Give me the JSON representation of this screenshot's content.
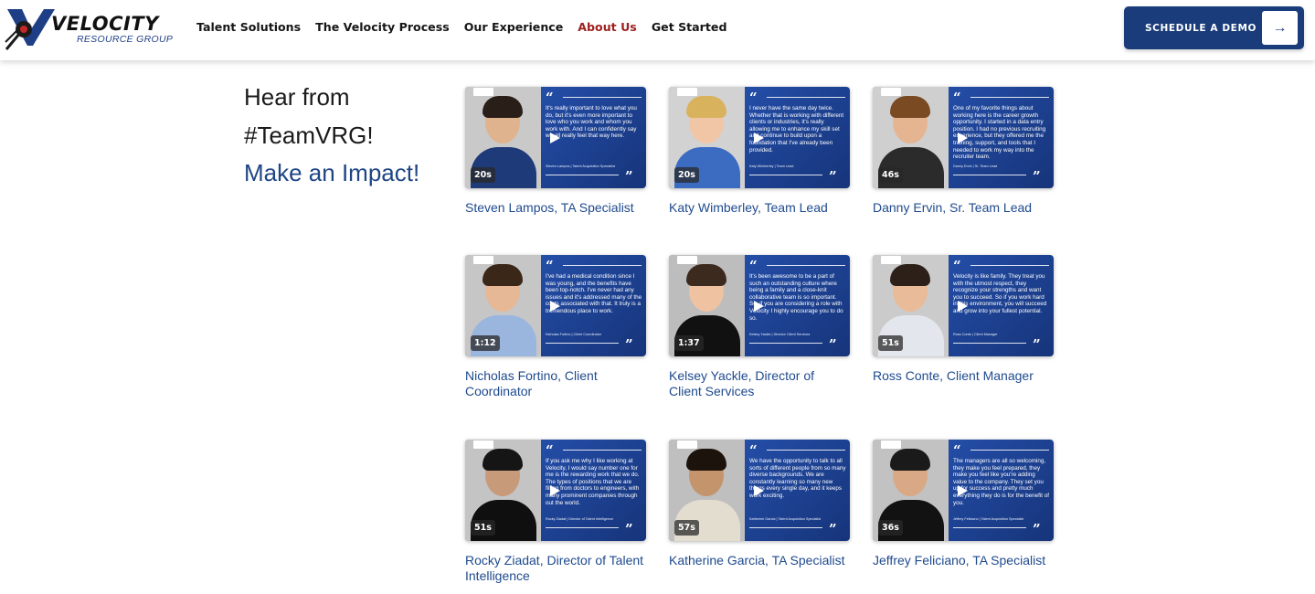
{
  "brand": {
    "name": "VELOCITY",
    "subtitle": "RESOURCE GROUP"
  },
  "nav": {
    "items": [
      {
        "label": "Talent Solutions",
        "active": false
      },
      {
        "label": "The Velocity Process",
        "active": false
      },
      {
        "label": "Our Experience",
        "active": false
      },
      {
        "label": "About Us",
        "active": true
      },
      {
        "label": "Get Started",
        "active": false
      }
    ]
  },
  "cta": {
    "label": "SCHEDULE A DEMO",
    "arrow": "→"
  },
  "intro": {
    "line1": "Hear from",
    "line2": "#TeamVRG!",
    "line3": "Make an Impact!"
  },
  "colors": {
    "brand_blue": "#1b3c7a",
    "active_nav": "#9e1f1f",
    "caption_blue": "#1e4a8e",
    "card_gradient": "#2957b8"
  },
  "videos": [
    {
      "caption": "Steven Lampos, TA Specialist",
      "duration": "20s",
      "quote": "It's really important to love what you do, but it's even more important to love who you work and whom you work with. And I can confidently say we all really feel that way here.",
      "signature": "Steven Lampos | Talent Acquisition Specialist"
    },
    {
      "caption": "Katy Wimberley, Team Lead",
      "duration": "20s",
      "quote": "I never have the same day twice. Whether that is working with different clients or industries, it's really allowing me to enhance my skill set and continue to build upon a foundation that I've already been provided.",
      "signature": "Katy Wimberley | Team Lead"
    },
    {
      "caption": "Danny Ervin, Sr. Team Lead",
      "duration": "46s",
      "quote": "One of my favorite things about working here is the career growth opportunity. I started in a data entry position. I had no previous recruiting experience, but they offered me the training, support, and tools that I needed to work my way into the recruiter team.",
      "signature": "Danny Ervin | Sr. Team Lead"
    },
    {
      "caption": "Nicholas Fortino, Client Coordinator",
      "duration": "1:12",
      "quote": "I've had a medical condition since I was young, and the benefits have been top-notch. I've never had any issues and it's addressed many of the costs associated with that. It truly is a tremendous place to work.",
      "signature": "Nicholas Fortino | Client Coordinator"
    },
    {
      "caption": "Kelsey Yackle, Director of Client Services",
      "duration": "1:37",
      "quote": "It's been awesome to be a part of such an outstanding culture where being a family and a close-knit collaborative team is so important. So, if you are considering a role with Velocity I highly encourage you to do so.",
      "signature": "Kelsey Yackle | Director Client Services"
    },
    {
      "caption": "Ross Conte, Client Manager",
      "duration": "51s",
      "quote": "Velocity is like family. They treat you with the utmost respect, they recognize your strengths and want you to succeed. So if you work hard in this environment, you will succeed and grow into your fullest potential.",
      "signature": "Ross Conte | Client Manager"
    },
    {
      "caption": "Rocky Ziadat, Director of Talent Intelligence",
      "duration": "51s",
      "quote": "If you ask me why I like working at Velocity, I would say number one for me is the rewarding work that we do. The types of positions that we are filling from doctors to engineers, with many prominent companies through out the world.",
      "signature": "Rocky Ziadat | Director of Talent Intelligence"
    },
    {
      "caption": "Katherine Garcia, TA Specialist",
      "duration": "57s",
      "quote": "We have the opportunity to talk to all sorts of different people from so many diverse backgrounds. We are constantly learning so many new things every single day, and it keeps work exciting.",
      "signature": "Katherine Garcia | Talent Acquisition Specialist"
    },
    {
      "caption": "Jeffrey Feliciano, TA Specialist",
      "duration": "36s",
      "quote": "The managers are all so welcoming, they make you feel prepared, they make you feel like you're adding value to the company. They set you up for success and pretty much everything they do is for the benefit of you.",
      "signature": "Jeffrey Feliciano | Talent Acquisition Specialist"
    }
  ]
}
